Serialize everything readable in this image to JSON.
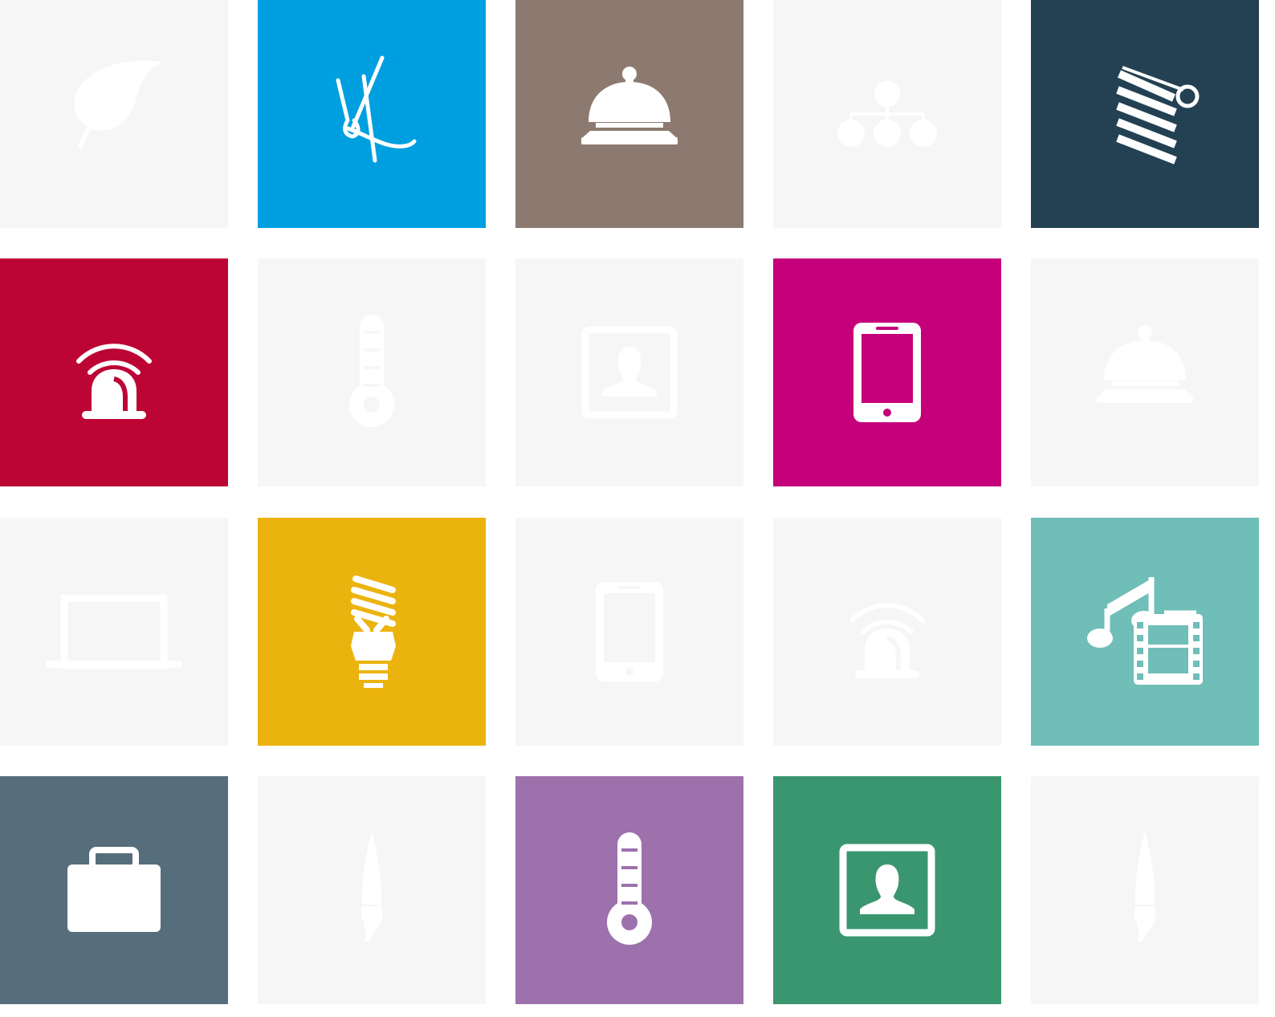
{
  "tiles": [
    {
      "icon": "leaf-icon",
      "color": "#f6f6f6",
      "active": false
    },
    {
      "icon": "kite-icon",
      "color": "#009fe0",
      "active": true
    },
    {
      "icon": "service-bell-icon",
      "color": "#8c7a71",
      "active": true
    },
    {
      "icon": "org-chart-icon",
      "color": "#f6f6f6",
      "active": false
    },
    {
      "icon": "window-blind-icon",
      "color": "#234152",
      "active": true
    },
    {
      "icon": "siren-alarm-icon",
      "color": "#bd0535",
      "active": true
    },
    {
      "icon": "thermometer-icon",
      "color": "#f6f6f6",
      "active": false
    },
    {
      "icon": "contact-photo-icon",
      "color": "#f6f6f6",
      "active": false
    },
    {
      "icon": "tablet-icon",
      "color": "#c5007a",
      "active": true
    },
    {
      "icon": "service-bell-icon",
      "color": "#f6f6f6",
      "active": false
    },
    {
      "icon": "laptop-icon",
      "color": "#f6f6f6",
      "active": false
    },
    {
      "icon": "energy-bulb-icon",
      "color": "#ebb30e",
      "active": true
    },
    {
      "icon": "tablet-icon",
      "color": "#f6f6f6",
      "active": false
    },
    {
      "icon": "siren-alarm-icon",
      "color": "#f6f6f6",
      "active": false
    },
    {
      "icon": "media-music-film-icon",
      "color": "#6fbeb8",
      "active": true
    },
    {
      "icon": "briefcase-icon",
      "color": "#566e7b",
      "active": true
    },
    {
      "icon": "paintbrush-icon",
      "color": "#f6f6f6",
      "active": false
    },
    {
      "icon": "thermometer-icon",
      "color": "#9d71ac",
      "active": true
    },
    {
      "icon": "contact-photo-icon",
      "color": "#3a966e",
      "active": true
    },
    {
      "icon": "paintbrush-icon",
      "color": "#f6f6f6",
      "active": false
    }
  ],
  "colors": {
    "icon_on_color": "#ffffff",
    "icon_on_light": "#ffffff"
  }
}
